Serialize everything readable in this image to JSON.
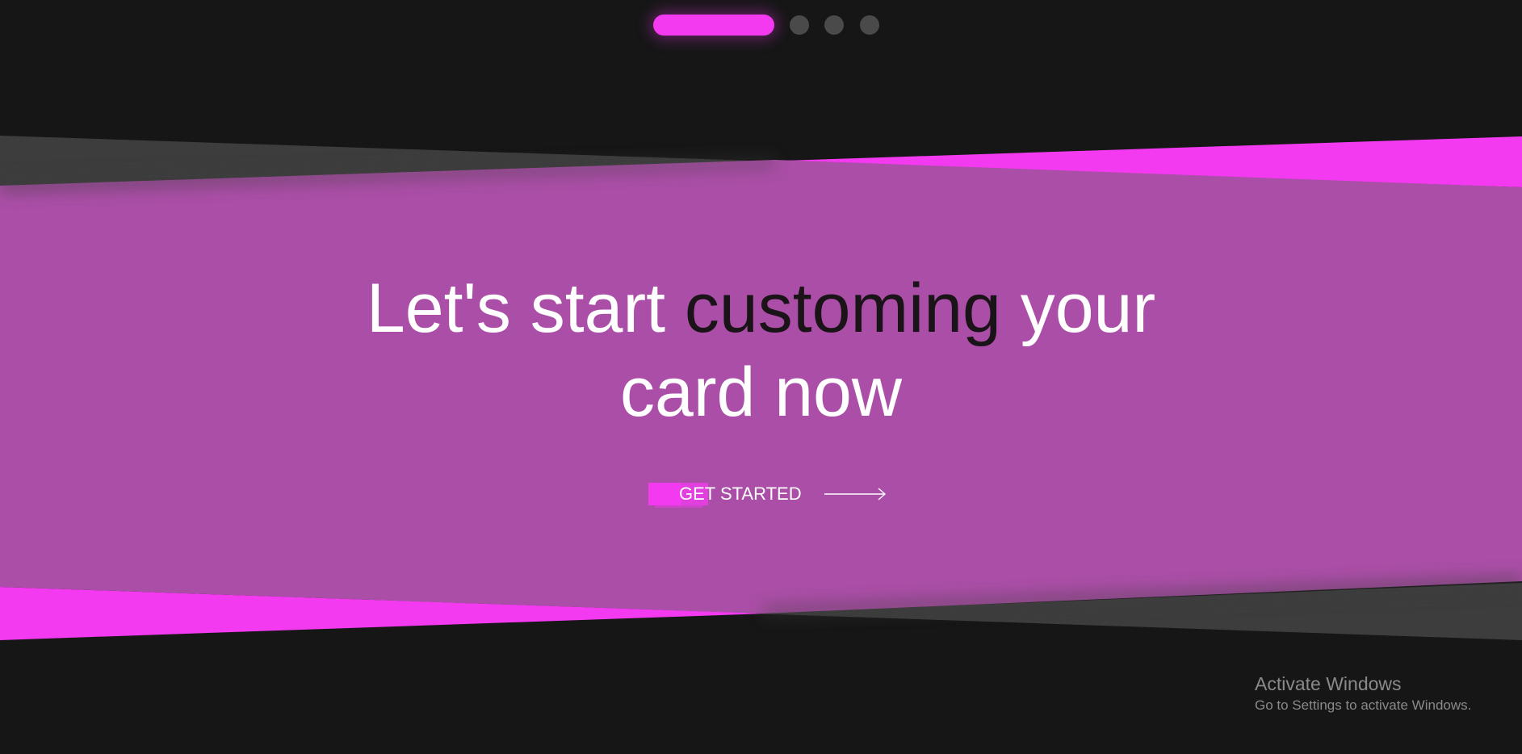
{
  "pager": {
    "total": 4,
    "active_index": 0
  },
  "hero": {
    "line1_part1": "Let's start ",
    "line1_part2": "customing",
    "line1_part3": " your",
    "line2": "card now"
  },
  "cta": {
    "label": "GET STARTED",
    "icon": "arrow-right-icon"
  },
  "watermark": {
    "title": "Activate Windows",
    "subtitle": "Go to Settings to activate Windows."
  },
  "colors": {
    "background": "#161616",
    "band": "#ab4ea7",
    "accent": "#f33af0",
    "inactive_dot": "#4a4a4a",
    "dark_text": "#1a1418",
    "gray_wedge": "#3d3d3d"
  }
}
